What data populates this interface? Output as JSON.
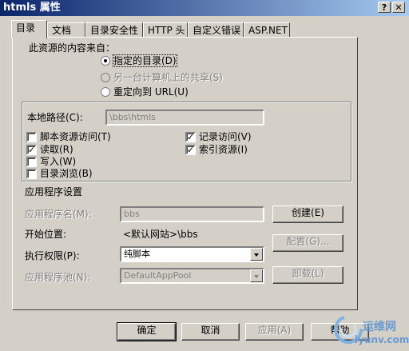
{
  "window": {
    "title": "htmls 属性",
    "help_btn": "?",
    "close_btn": "✕"
  },
  "tabs": [
    {
      "label": "目录"
    },
    {
      "label": "文档"
    },
    {
      "label": "目录安全性"
    },
    {
      "label": "HTTP 头"
    },
    {
      "label": "自定义错误"
    },
    {
      "label": "ASP.NET"
    }
  ],
  "content_source": {
    "heading": "此资源的内容来自：",
    "options": [
      {
        "label": "指定的目录(D)",
        "selected": true,
        "enabled": true
      },
      {
        "label": "另一台计算机上的共享(S)",
        "selected": false,
        "enabled": false
      },
      {
        "label": "重定向到 URL(U)",
        "selected": false,
        "enabled": true
      }
    ]
  },
  "local_path": {
    "label": "本地路径(C):",
    "value": "\\bbs\\htmls"
  },
  "checkboxes": {
    "script_source": {
      "label": "脚本资源访问(T)",
      "checked": false
    },
    "read": {
      "label": "读取(R)",
      "checked": true
    },
    "write": {
      "label": "写入(W)",
      "checked": false
    },
    "dir_browse": {
      "label": "目录浏览(B)",
      "checked": false
    },
    "log_visits": {
      "label": "记录访问(V)",
      "checked": true
    },
    "index": {
      "label": "索引资源(I)",
      "checked": true
    }
  },
  "app_settings": {
    "heading": "应用程序设置",
    "app_name_label": "应用程序名(M):",
    "app_name_value": "bbs",
    "create_btn": "创建(E)",
    "start_label": "开始位置:",
    "start_value": "<默认网站>\\bbs",
    "config_btn": "配置(G)...",
    "exec_label": "执行权限(P):",
    "exec_value": "纯脚本",
    "pool_label": "应用程序池(N):",
    "pool_value": "DefaultAppPool",
    "unload_btn": "卸载(L)"
  },
  "footer": {
    "ok": "确定",
    "cancel": "取消",
    "apply": "应用(A)",
    "help": "帮助"
  },
  "watermark": {
    "line1": "运维网",
    "line2": "iyunv.com"
  },
  "checkmark": "✓"
}
